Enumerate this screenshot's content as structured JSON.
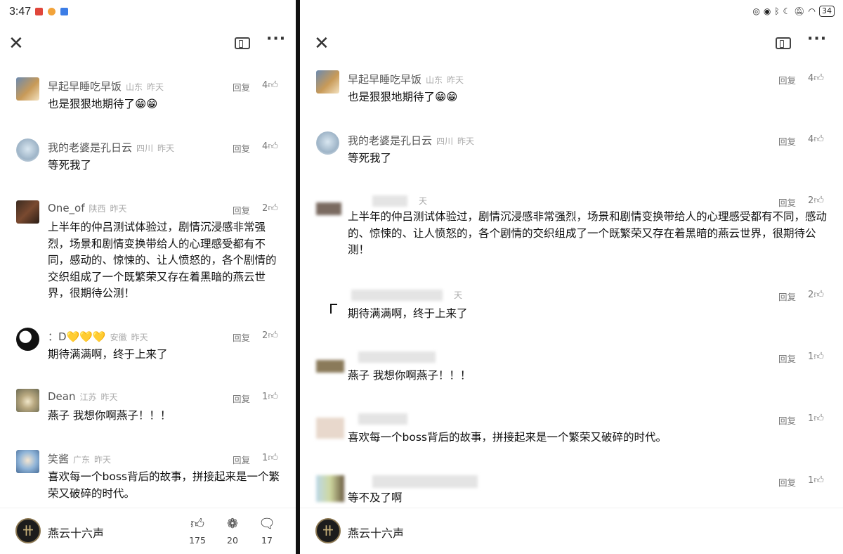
{
  "status": {
    "time": "3:47",
    "battery": "34"
  },
  "left": {
    "comments": [
      {
        "user": "早起早睡吃早饭",
        "region": "山东",
        "time": "昨天",
        "reply": "回复",
        "likes": "4",
        "text": "也是狠狠地期待了😁😁"
      },
      {
        "user": "我的老婆是孔日云",
        "region": "四川",
        "time": "昨天",
        "reply": "回复",
        "likes": "4",
        "text": "等死我了"
      },
      {
        "user": "One_of",
        "region": "陕西",
        "time": "昨天",
        "reply": "回复",
        "likes": "2",
        "text": "上半年的仲吕测试体验过，剧情沉浸感非常强烈，场景和剧情变换带给人的心理感受都有不同，感动的、惊悚的、让人愤怒的，各个剧情的交织组成了一个既繁荣又存在着黑暗的燕云世界，很期待公测！"
      },
      {
        "user": "：D💛💛💛",
        "region": "安徽",
        "time": "昨天",
        "reply": "回复",
        "likes": "2",
        "text": "期待满满啊，终于上来了"
      },
      {
        "user": "Dean",
        "region": "江苏",
        "time": "昨天",
        "reply": "回复",
        "likes": "1",
        "text": "燕子 我想你啊燕子！！！"
      },
      {
        "user": "笑酱",
        "region": "广东",
        "time": "昨天",
        "reply": "回复",
        "likes": "1",
        "text": "喜欢每一个boss背后的故事，拼接起来是一个繁荣又破碎的时代。"
      }
    ],
    "bottom": {
      "game": "燕云十六声",
      "likes": "175",
      "shares": "20",
      "comments": "17"
    }
  },
  "right": {
    "comments": [
      {
        "user": "早起早睡吃早饭",
        "region": "山东",
        "time": "昨天",
        "reply": "回复",
        "likes": "4",
        "text": "也是狠狠地期待了😁😁"
      },
      {
        "user": "我的老婆是孔日云",
        "region": "四川",
        "time": "昨天",
        "reply": "回复",
        "likes": "4",
        "text": "等死我了"
      },
      {
        "user": "",
        "region": "",
        "time": "天",
        "reply": "回复",
        "likes": "2",
        "text": "上半年的仲吕测试体验过，剧情沉浸感非常强烈，场景和剧情变换带给人的心理感受都有不同，感动的、惊悚的、让人愤怒的，各个剧情的交织组成了一个既繁荣又存在着黑暗的燕云世界，很期待公测！"
      },
      {
        "user": "",
        "region": "",
        "time": "天",
        "reply": "回复",
        "likes": "2",
        "text": "期待满满啊，终于上来了"
      },
      {
        "user": "",
        "region": "",
        "time": "",
        "reply": "回复",
        "likes": "1",
        "text": "燕子 我想你啊燕子！！！"
      },
      {
        "user": "",
        "region": "",
        "time": "",
        "reply": "回复",
        "likes": "1",
        "text": "喜欢每一个boss背后的故事，拼接起来是一个繁荣又破碎的时代。"
      },
      {
        "user": "",
        "region": "",
        "time": "",
        "reply": "回复",
        "likes": "1",
        "text": "等不及了啊"
      }
    ],
    "bottom": {
      "game": "燕云十六声"
    }
  }
}
